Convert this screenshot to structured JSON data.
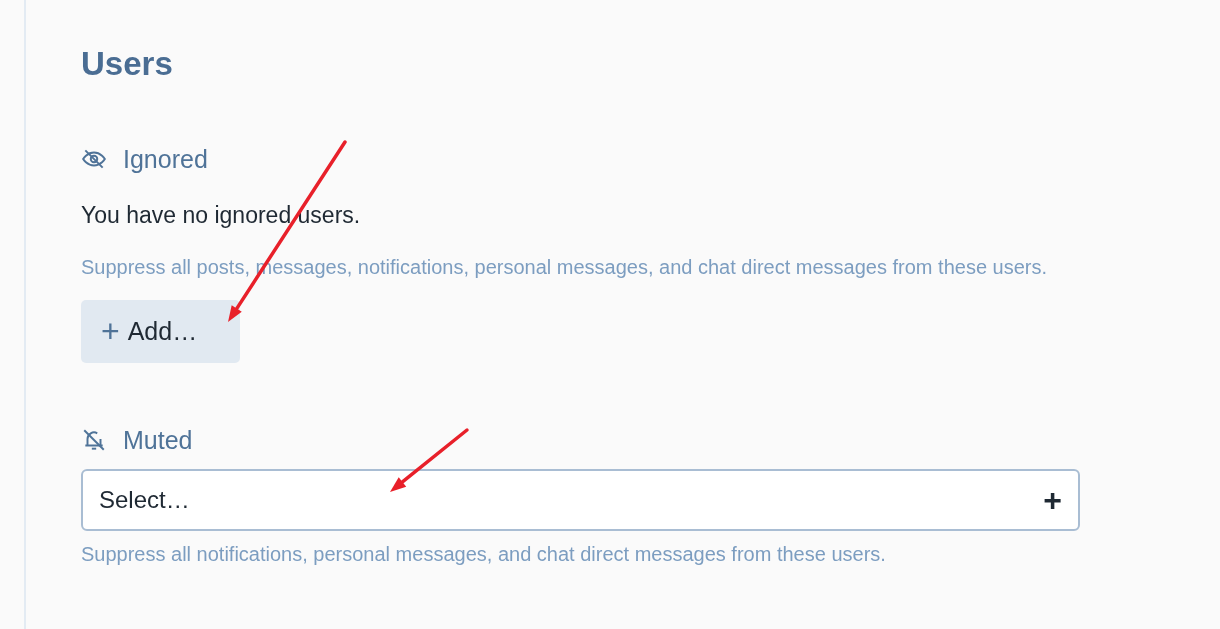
{
  "section": {
    "title": "Users"
  },
  "ignored": {
    "label": "Ignored",
    "empty_text": "You have no ignored users.",
    "description": "Suppress all posts, messages, notifications, personal messages, and chat direct messages from these users.",
    "button": {
      "icon": "+",
      "label": "Add…"
    }
  },
  "muted": {
    "label": "Muted",
    "select": {
      "placeholder": "Select…",
      "icon": "+"
    },
    "description": "Suppress all notifications, personal messages, and chat direct messages from these users."
  },
  "annotations": [
    {
      "kind": "arrow"
    },
    {
      "kind": "arrow"
    }
  ]
}
